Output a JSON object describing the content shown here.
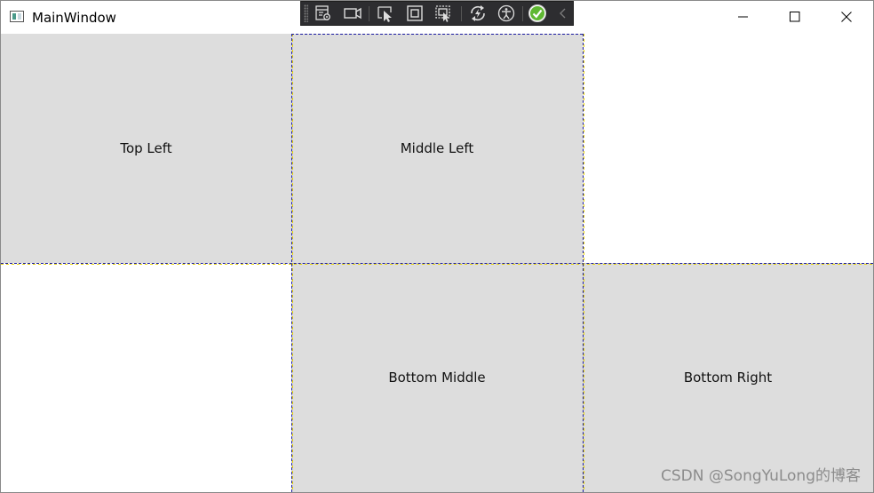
{
  "window": {
    "title": "MainWindow"
  },
  "debug_toolbar": {
    "icons": [
      "live-visual-tree-icon",
      "camera-icon",
      "select-element-icon",
      "display-layout-adorners-icon",
      "track-focus-icon",
      "hot-reload-icon",
      "accessibility-icon",
      "binding-check-icon",
      "collapse-chevron-icon"
    ]
  },
  "window_controls": [
    "minimize-icon",
    "maximize-icon",
    "close-icon"
  ],
  "grid": {
    "cells": {
      "top_left": "Top Left",
      "middle_left": "Middle Left",
      "bottom_middle": "Bottom Middle",
      "bottom_right": "Bottom Right"
    }
  },
  "colors": {
    "cell_background": "#dddddd",
    "toolbar_background": "#2d2d30",
    "outline_blue": "#1a1aa0",
    "outline_yellow": "#e8d400",
    "check_green": "#5fb832"
  },
  "watermark": "CSDN @SongYuLong的博客"
}
